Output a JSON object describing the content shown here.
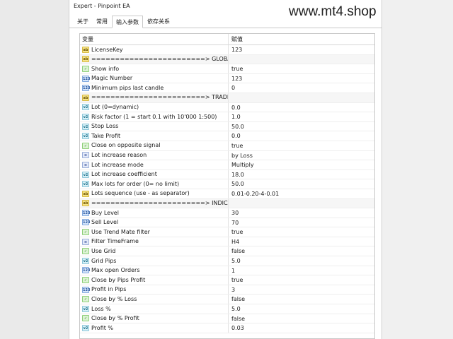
{
  "window": {
    "title": "Expert - Pinpoint EA"
  },
  "watermark": "www.mt4.shop",
  "tabs": [
    "关于",
    "常用",
    "输入参数",
    "依存关系"
  ],
  "active_tab": 2,
  "grid": {
    "headers": {
      "name": "变量",
      "value": "赋值"
    },
    "rows": [
      {
        "icon": "ab",
        "name": "LicenseKey",
        "value": "123"
      },
      {
        "icon": "ab",
        "name": "========================> GLOBAL",
        "value": "",
        "section": true
      },
      {
        "icon": "bool",
        "name": "Show info",
        "value": "true"
      },
      {
        "icon": "123",
        "name": "Magic Number",
        "value": "123"
      },
      {
        "icon": "123",
        "name": "Minimum pips last candle",
        "value": "0"
      },
      {
        "icon": "ab",
        "name": "========================> TRADES",
        "value": "",
        "section": true
      },
      {
        "icon": "v2",
        "name": "Lot (0=dynamic)",
        "value": "0.0"
      },
      {
        "icon": "v2",
        "name": "Risk factor (1 = start 0.1 with 10'000 1:500)",
        "value": "1.0"
      },
      {
        "icon": "v2",
        "name": "Stop Loss",
        "value": "50.0"
      },
      {
        "icon": "v2",
        "name": "Take Profit",
        "value": "0.0"
      },
      {
        "icon": "bool",
        "name": "Close on opposite signal",
        "value": "true"
      },
      {
        "icon": "enum",
        "name": "Lot increase reason",
        "value": "by Loss"
      },
      {
        "icon": "enum",
        "name": "Lot increase mode",
        "value": "Multiply"
      },
      {
        "icon": "v2",
        "name": "Lot increase coefficient",
        "value": "18.0"
      },
      {
        "icon": "v2",
        "name": "Max lots for order (0= no limit)",
        "value": "50.0"
      },
      {
        "icon": "ab",
        "name": "Lots sequence (use - as separator)",
        "value": "0.01-0.20-4-0.01"
      },
      {
        "icon": "ab",
        "name": "========================> INDICATORS",
        "value": "",
        "section": true
      },
      {
        "icon": "123",
        "name": "Buy Level",
        "value": "30"
      },
      {
        "icon": "123",
        "name": "Sell Level",
        "value": "70"
      },
      {
        "icon": "bool",
        "name": "Use Trend Mate filter",
        "value": "true"
      },
      {
        "icon": "enum",
        "name": "Filter TimeFrame",
        "value": "H4"
      },
      {
        "icon": "bool",
        "name": "Use Grid",
        "value": "false"
      },
      {
        "icon": "v2",
        "name": "Grid Pips",
        "value": "5.0"
      },
      {
        "icon": "123",
        "name": "Max open Orders",
        "value": "1"
      },
      {
        "icon": "bool",
        "name": "Close by Pips Profit",
        "value": "true"
      },
      {
        "icon": "123",
        "name": "Profit in Pips",
        "value": "3"
      },
      {
        "icon": "bool",
        "name": "Close by % Loss",
        "value": "false"
      },
      {
        "icon": "v2",
        "name": "Loss %",
        "value": "5.0"
      },
      {
        "icon": "bool",
        "name": "Close by % Profit",
        "value": "false"
      },
      {
        "icon": "v2",
        "name": "Profit %",
        "value": "0.03"
      }
    ]
  },
  "icon_labels": {
    "ab": "ab",
    "123": "123",
    "v2": "v2",
    "bool": "✓",
    "enum": "≡"
  }
}
